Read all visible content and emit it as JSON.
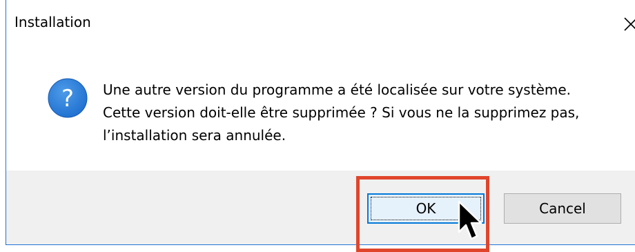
{
  "window": {
    "title": "Installation",
    "close_icon": "close-icon"
  },
  "dialog": {
    "icon": "question-icon",
    "icon_glyph": "?",
    "icon_color": "#1e6fd0",
    "message_lines": [
      "Une autre version du programme a été localisée sur votre système.",
      "Cette version doit-elle être supprimée ? Si vous ne la supprimez pas,",
      "l’installation sera annulée."
    ]
  },
  "buttons": {
    "ok_label": "OK",
    "cancel_label": "Cancel"
  },
  "annotation": {
    "highlight_color": "#e0452c",
    "cursor_icon": "mouse-pointer-icon"
  }
}
